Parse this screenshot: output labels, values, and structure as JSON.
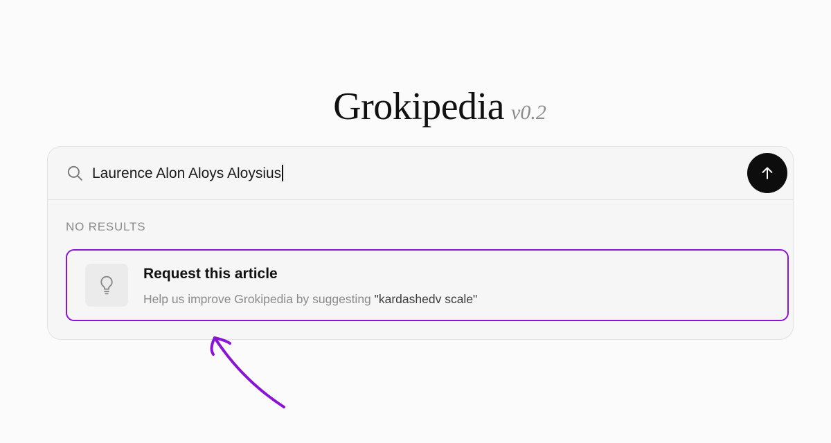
{
  "header": {
    "logo_name": "Grokipedia",
    "logo_version": "v0.2"
  },
  "search": {
    "query": "Laurence Alon Aloys Aloysius",
    "icon": "search-icon",
    "submit_icon": "arrow-up-icon"
  },
  "results": {
    "status_label": "NO RESULTS",
    "request_card": {
      "icon": "lightbulb-icon",
      "title": "Request this article",
      "description": "Help us improve Grokipedia by suggesting ",
      "query_quoted": "\"kardashedv scale\""
    }
  },
  "annotation": {
    "icon": "hand-drawn-arrow",
    "color": "#8a14d6"
  },
  "colors": {
    "accent": "#8a14d6",
    "submit_button": "#0d0d0d"
  }
}
